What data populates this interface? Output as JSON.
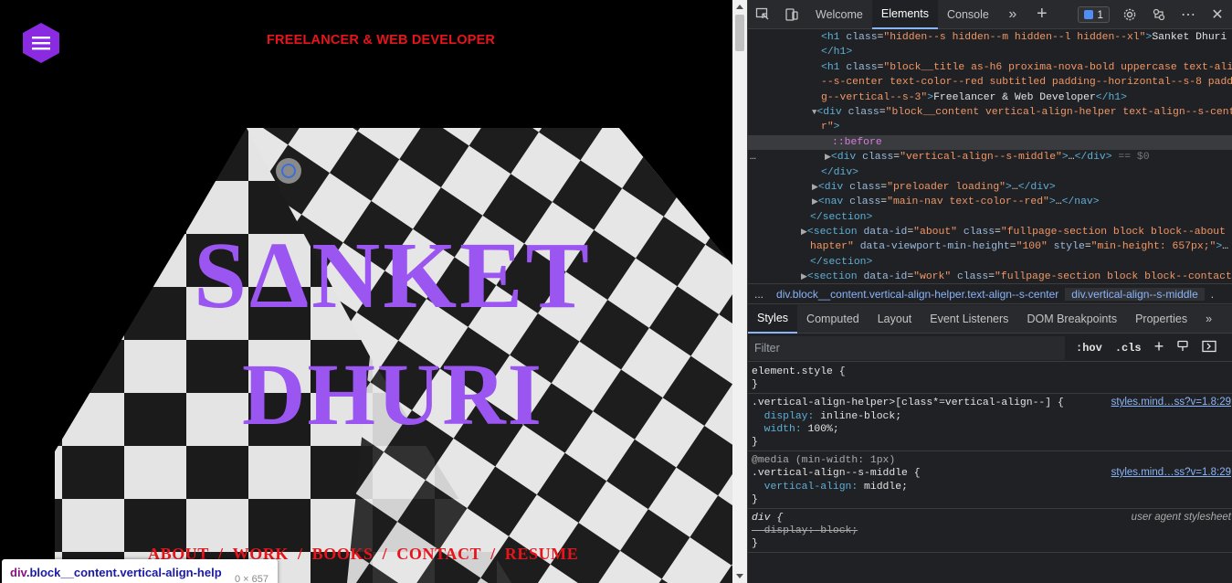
{
  "page": {
    "tagline": "FREELANCER & WEB DEVELOPER",
    "name_line1": "SΔNKET",
    "name_line2": "DHURI",
    "nav": [
      "ABOUT",
      "WORK",
      "BOOKS",
      "CONTACT",
      "RESUME"
    ],
    "nav_separator": "/",
    "inspect_tooltip": {
      "selector_tag": "div",
      "selector_class": ".block__content.vertical-align-help",
      "size": "0 × 657"
    }
  },
  "colors": {
    "accent_red": "#e8141b",
    "name_purple": "#9b55f0",
    "menu_purple": "#8a2be2"
  },
  "devtools": {
    "tabs": [
      "Welcome",
      "Elements",
      "Console"
    ],
    "active_tab": "Elements",
    "issues_count": "1",
    "icons": [
      "inspect-icon",
      "device-toggle-icon",
      "more-tabs-icon",
      "new-tab-icon",
      "settings-icon",
      "remote-icon",
      "more-menu-icon",
      "close-icon"
    ],
    "dom_lines": [
      {
        "indent": 80,
        "html": "<span class='tg'>&lt;h1</span> <span class='at'>class</span><span class='tx'>=</span><span class='av'>\"hidden--s hidden--m hidden--l hidden--xl\"</span><span class='tg'>&gt;</span><span class='tx'>Sanket Dhuri</span>"
      },
      {
        "indent": 80,
        "html": "<span class='tg'>&lt;/h1&gt;</span>"
      },
      {
        "indent": 80,
        "html": "<span class='tg'>&lt;h1</span> <span class='at'>class</span><span class='tx'>=</span><span class='av'>\"block__title as-h6 proxima-nova-bold uppercase text-align</span>"
      },
      {
        "indent": 80,
        "html": "<span class='av'>--s-center text-color--red subtitled padding--horizontal--s-8 paddin</span>"
      },
      {
        "indent": 80,
        "html": "<span class='av'>g--vertical--s-3\"</span><span class='tg'>&gt;</span><span class='tx'>Freelancer &amp; Web Developer</span><span class='tg'>&lt;/h1&gt;</span>"
      },
      {
        "indent": 70,
        "html": "<span class='tri'>▼</span><span class='tg'>&lt;div</span> <span class='at'>class</span><span class='tx'>=</span><span class='av'>\"block__content vertical-align-helper text-align--s-cente</span>"
      },
      {
        "indent": 80,
        "html": "<span class='av'>r\"</span><span class='tg'>&gt;</span>"
      },
      {
        "indent": 92,
        "html": "<span class='ps'>::before</span>",
        "selected_bg": true
      },
      {
        "indent": 84,
        "html": "<span class='tri'>▶</span><span class='tg'>&lt;div</span> <span class='at'>class</span><span class='tx'>=</span><span class='av'>\"vertical-align--s-middle\"</span><span class='tg'>&gt;</span><span class='tx'>…</span><span class='tg'>&lt;/div&gt;</span> <span class='cm'>== $0</span>",
        "selected": true
      },
      {
        "indent": 80,
        "html": "<span class='tg'>&lt;/div&gt;</span>"
      },
      {
        "indent": 70,
        "html": "<span class='tri'>▶</span><span class='tg'>&lt;div</span> <span class='at'>class</span><span class='tx'>=</span><span class='av'>\"preloader loading\"</span><span class='tg'>&gt;</span><span class='tx'>…</span><span class='tg'>&lt;/div&gt;</span>"
      },
      {
        "indent": 70,
        "html": "<span class='tri'>▶</span><span class='tg'>&lt;nav</span> <span class='at'>class</span><span class='tx'>=</span><span class='av'>\"main-nav text-color--red\"</span><span class='tg'>&gt;</span><span class='tx'>…</span><span class='tg'>&lt;/nav&gt;</span>"
      },
      {
        "indent": 68,
        "html": "<span class='tg'>&lt;/section&gt;</span>"
      },
      {
        "indent": 58,
        "html": "<span class='tri'>▶</span><span class='tg'>&lt;section</span> <span class='at'>data-id</span><span class='tx'>=</span><span class='av'>\"about\"</span> <span class='at'>class</span><span class='tx'>=</span><span class='av'>\"fullpage-section block block--about c</span>"
      },
      {
        "indent": 68,
        "html": "<span class='av'>hapter\"</span> <span class='at'>data-viewport-min-height</span><span class='tx'>=</span><span class='av'>\"100\"</span> <span class='at'>style</span><span class='tx'>=</span><span class='av'>\"min-height: 657px;\"</span><span class='tg'>&gt;</span><span class='tx'>…</span>"
      },
      {
        "indent": 68,
        "html": "<span class='tg'>&lt;/section&gt;</span>"
      },
      {
        "indent": 58,
        "html": "<span class='tri'>▶</span><span class='tg'>&lt;section</span> <span class='at'>data-id</span><span class='tx'>=</span><span class='av'>\"work\"</span> <span class='at'>class</span><span class='tx'>=</span><span class='av'>\"fullpage-section block block--contact</span>"
      }
    ],
    "breadcrumbs": [
      "...",
      "div.block__content.vertical-align-helper.text-align--s-center",
      "div.vertical-align--s-middle",
      "."
    ],
    "sub_tabs": [
      "Styles",
      "Computed",
      "Layout",
      "Event Listeners",
      "DOM Breakpoints",
      "Properties",
      "»"
    ],
    "active_sub_tab": "Styles",
    "filter_placeholder": "Filter",
    "filter_tools": [
      ":hov",
      ".cls"
    ],
    "styles": [
      {
        "selector": "element.style {",
        "lines": [
          "}"
        ],
        "source": ""
      },
      {
        "selector": ".vertical-align-helper>[class*=vertical-align--] {",
        "lines": [
          "  display: inline-block;",
          "  width: 100%;",
          "}"
        ],
        "source": "styles.mind…ss?v=1.8:29"
      },
      {
        "media": "@media (min-width: 1px)",
        "selector": ".vertical-align--s-middle {",
        "lines": [
          "  vertical-align: middle;",
          "}"
        ],
        "source": "styles.mind…ss?v=1.8:29"
      },
      {
        "selector": "div {",
        "lines": [
          "  display: block;",
          "}"
        ],
        "source": "",
        "ua": "user agent stylesheet",
        "strike": true
      }
    ]
  }
}
